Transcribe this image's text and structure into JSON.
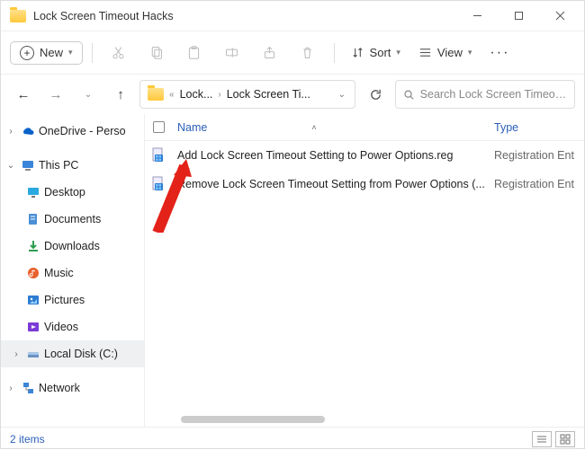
{
  "window": {
    "title": "Lock Screen Timeout Hacks"
  },
  "toolbar": {
    "new_label": "New",
    "sort_label": "Sort",
    "view_label": "View"
  },
  "breadcrumb": {
    "seg1": "Lock...",
    "seg2": "Lock Screen Ti..."
  },
  "search": {
    "placeholder": "Search Lock Screen Timeou..."
  },
  "columns": {
    "name": "Name",
    "type": "Type"
  },
  "sidebar": {
    "onedrive": "OneDrive - Perso",
    "thispc": "This PC",
    "desktop": "Desktop",
    "documents": "Documents",
    "downloads": "Downloads",
    "music": "Music",
    "pictures": "Pictures",
    "videos": "Videos",
    "localdisk": "Local Disk (C:)",
    "network": "Network"
  },
  "files": [
    {
      "name": "Add Lock Screen Timeout Setting to Power Options.reg",
      "type": "Registration Ent"
    },
    {
      "name": "Remove Lock Screen Timeout Setting from Power Options (...",
      "type": "Registration Ent"
    }
  ],
  "status": {
    "count": "2 items"
  }
}
